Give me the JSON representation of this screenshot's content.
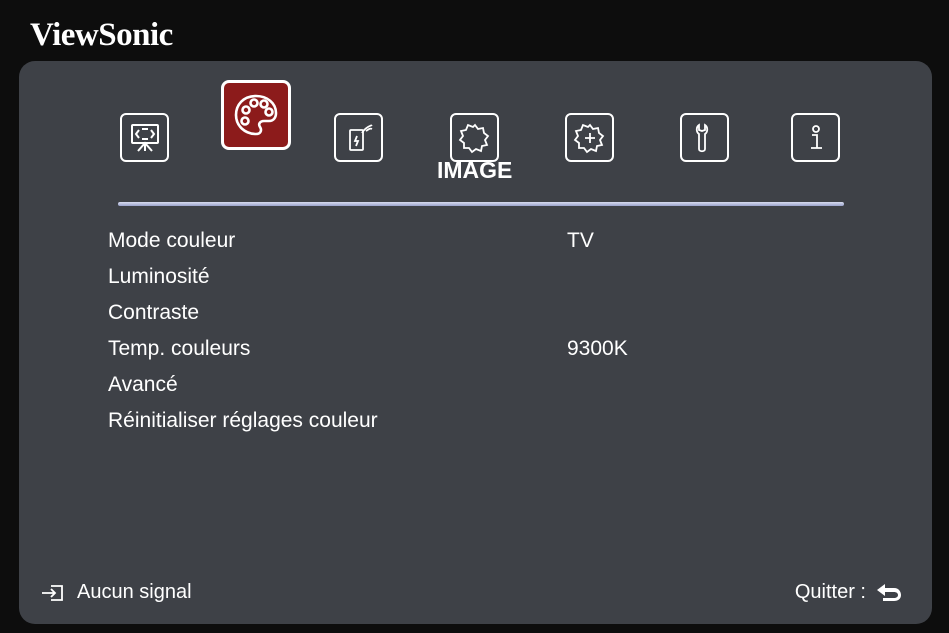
{
  "brand": "ViewSonic",
  "tabs": [
    {
      "name": "display",
      "icon": "display-screen-icon",
      "active": false
    },
    {
      "name": "image",
      "icon": "color-palette-icon",
      "active": true
    },
    {
      "name": "power",
      "icon": "power-management-icon",
      "active": false
    },
    {
      "name": "basic",
      "icon": "gear-basic-icon",
      "active": false
    },
    {
      "name": "advanced",
      "icon": "gear-advanced-icon",
      "active": false
    },
    {
      "name": "system",
      "icon": "wrench-icon",
      "active": false
    },
    {
      "name": "information",
      "icon": "info-icon",
      "active": false
    }
  ],
  "section_title": "IMAGE",
  "menu": [
    {
      "label": "Mode couleur",
      "value": "TV"
    },
    {
      "label": "Luminosité",
      "value": ""
    },
    {
      "label": "Contraste",
      "value": ""
    },
    {
      "label": "Temp. couleurs",
      "value": "9300K"
    },
    {
      "label": "Avancé",
      "value": ""
    },
    {
      "label": "Réinitialiser réglages couleur",
      "value": ""
    }
  ],
  "footer": {
    "source_status": "Aucun signal",
    "exit_label": "Quitter :"
  },
  "colors": {
    "panel": "#3e4147",
    "active_tab": "#8c1b1b",
    "rule": "#b7bde0",
    "text": "#ffffff"
  }
}
